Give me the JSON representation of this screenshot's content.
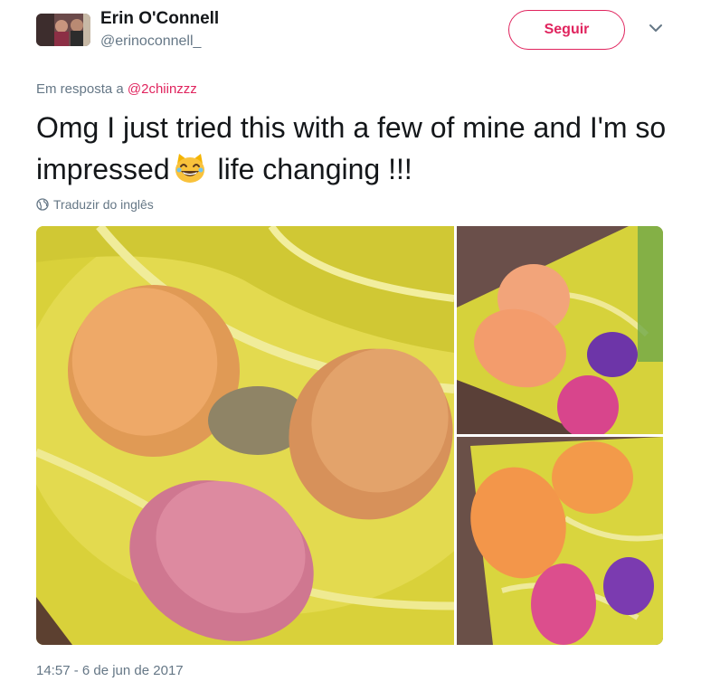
{
  "user": {
    "name": "Erin O'Connell",
    "handle": "@erinoconnell_"
  },
  "follow_button": {
    "label": "Seguir",
    "color": "#e0245e"
  },
  "reply": {
    "prefix": "Em resposta a",
    "mention": "@2chiinzzz"
  },
  "tweet": {
    "text_before_emoji": "Omg I just tried this with a few of mine and I'm so impressed",
    "emoji": "laughing-cat-emoji",
    "text_after_emoji": " life changing !!!"
  },
  "translate": {
    "label": "Traduzir do inglês",
    "icon": "globe-icon"
  },
  "timestamp": "14:57 - 6 de jun de 2017",
  "colors": {
    "text": "#14171a",
    "secondary": "#657786",
    "accent": "#e0245e"
  }
}
